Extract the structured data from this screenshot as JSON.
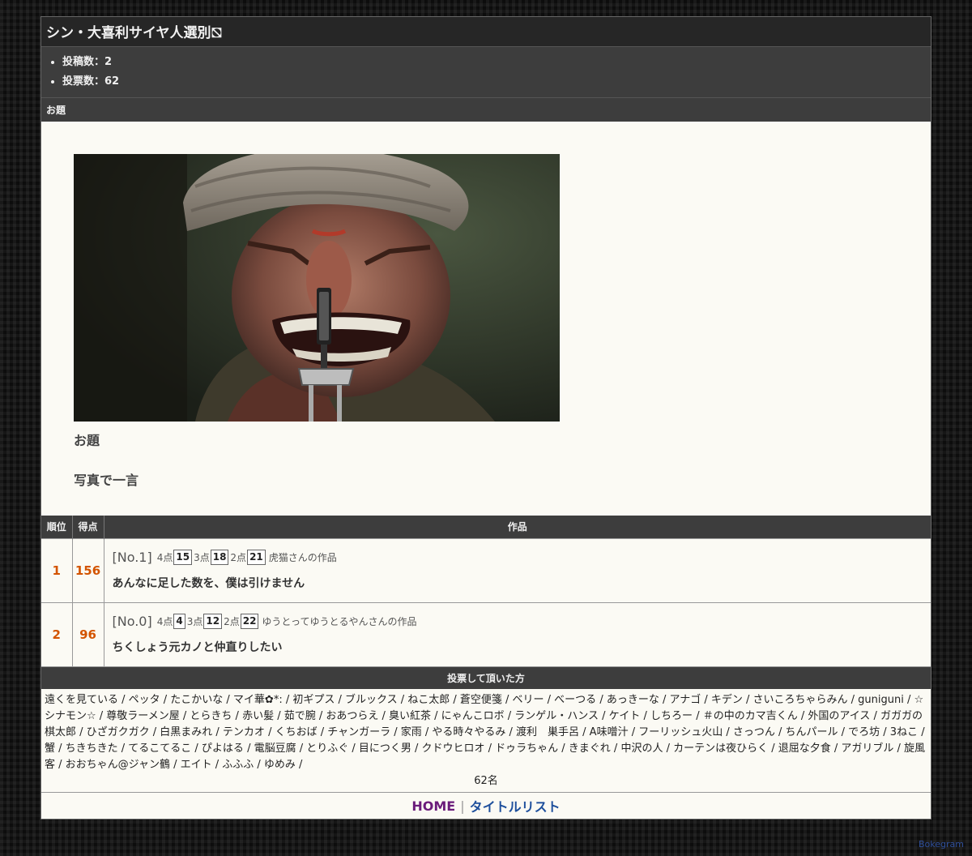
{
  "header": {
    "title": "シン・大喜利サイヤ人選別⛞"
  },
  "stats": {
    "items": [
      "投稿数：2",
      "投票数：62"
    ]
  },
  "odai": {
    "section_label": "お題",
    "image_icon": "photo-of-grimacing-man-with-nose-device",
    "label": "お題",
    "text": "写真で一言"
  },
  "results": {
    "headers": {
      "rank": "順位",
      "score": "得点",
      "work": "作品"
    },
    "rows": [
      {
        "rank": "1",
        "score": "156",
        "no": "[No.1]",
        "p4_label": "4点",
        "p4": "15",
        "p3_label": "3点",
        "p3": "18",
        "p2_label": "2点",
        "p2": "21",
        "author": "虎猫さんの作品",
        "text": "あんなに足した数を、僕は引けません"
      },
      {
        "rank": "2",
        "score": "96",
        "no": "[No.0]",
        "p4_label": "4点",
        "p4": "4",
        "p3_label": "3点",
        "p3": "12",
        "p2_label": "2点",
        "p2": "22",
        "author": "ゆうとってゆうとるやんさんの作品",
        "text": "ちくしょう元カノと仲直りしたい"
      }
    ]
  },
  "voters": {
    "heading": "投票して頂いた方",
    "list": "遠くを見ている / ペッタ / たこかいな / マイ華✿*: / 初ギプス / ブルックス / ねこ太郎 / 蒼空便箋 / ベリー / べーつる / あっきーな / アナゴ / キデン / さいころちゃらみん / guniguni / ☆シナモン☆ / 尊敬ラーメン屋 / とらきち / 赤い髪 / 茹で腕 / おあつらえ / 臭い紅茶 / にゃんこロボ / ランゲル・ハンス / ケイト / しちろー / ＃の中のカマ吉くん / 外国のアイス / ガガガの棋太郎 / ひざガクガク / 白黒まみれ / テンカオ / くちおば / チャンガーラ / 家雨 / やる時々やるみ / 渡利　巣手呂 / A味噌汁 / フーリッシュ火山 / さっつん / ちんパール / でろ坊 / 3ねこ / 蟹 / ちきちきた / てるこてるこ / ぴよはる / 電脳豆腐 / とりふぐ / 目につく男 / クドウヒロオ / ドゥラちゃん / きまぐれ / 中沢の人 / カーテンは夜ひらく / 退屈な夕食 / アガリブル / 旋風客 / おおちゃん@ジャン鶴 / エイト / ふふふ / ゆめみ /",
    "count": "62名"
  },
  "footer": {
    "home": "HOME",
    "separator": "|",
    "title_list": "タイトルリスト"
  },
  "watermark": "Bokegram"
}
